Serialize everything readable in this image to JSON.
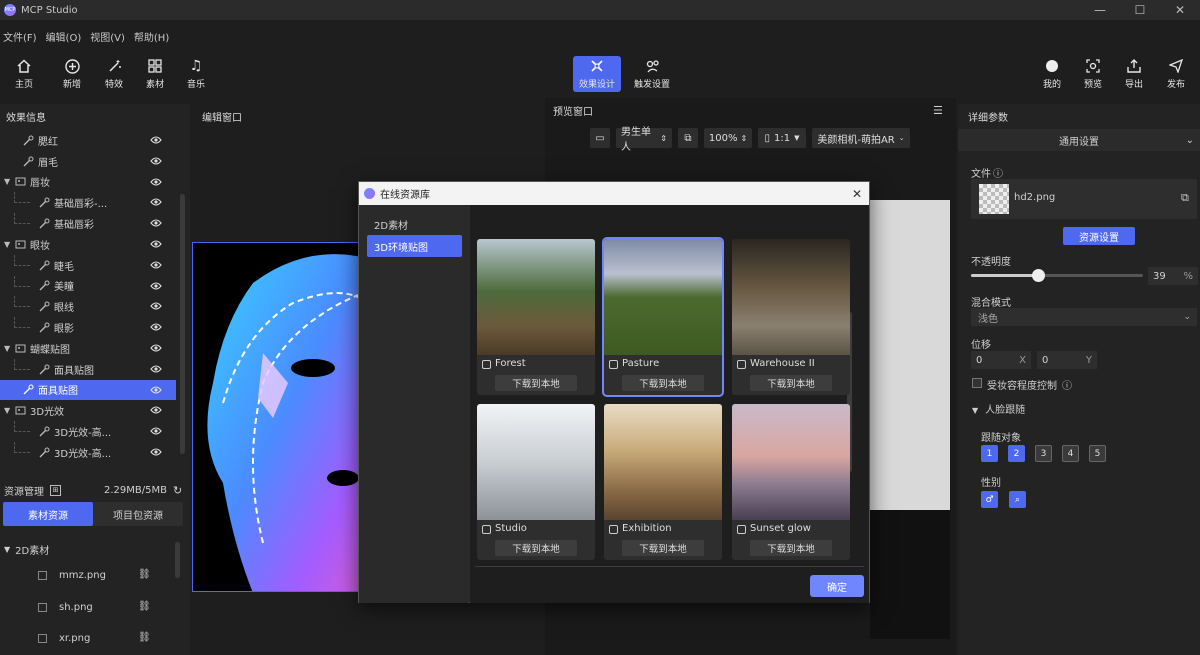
{
  "app": {
    "title": "MCP Studio",
    "logo_text": "MCP"
  },
  "menu": [
    "文件(F)",
    "编辑(O)",
    "视图(V)",
    "帮助(H)"
  ],
  "toolbar": {
    "left": [
      "主页",
      "新增",
      "特效",
      "素材",
      "音乐"
    ],
    "center": [
      "效果设计",
      "触发设置"
    ],
    "right": [
      "我的",
      "预览",
      "导出",
      "发布"
    ]
  },
  "effect_panel": {
    "title": "效果信息",
    "rows": [
      {
        "label": "腮红",
        "level": 1,
        "type": "item"
      },
      {
        "label": "眉毛",
        "level": 1,
        "type": "item"
      },
      {
        "label": "唇妆",
        "level": 0,
        "type": "group"
      },
      {
        "label": "基础唇彩-...",
        "level": 2,
        "type": "item"
      },
      {
        "label": "基础唇彩",
        "level": 2,
        "type": "item"
      },
      {
        "label": "眼妆",
        "level": 0,
        "type": "group"
      },
      {
        "label": "睫毛",
        "level": 2,
        "type": "item"
      },
      {
        "label": "美瞳",
        "level": 2,
        "type": "item"
      },
      {
        "label": "眼线",
        "level": 2,
        "type": "item"
      },
      {
        "label": "眼影",
        "level": 2,
        "type": "item"
      },
      {
        "label": "蝴蝶贴图",
        "level": 0,
        "type": "group"
      },
      {
        "label": "面具贴图",
        "level": 2,
        "type": "item"
      },
      {
        "label": "面具贴图",
        "level": 1,
        "type": "item",
        "selected": true
      },
      {
        "label": "3D光效",
        "level": 0,
        "type": "group"
      },
      {
        "label": "3D光效-高...",
        "level": 2,
        "type": "item"
      },
      {
        "label": "3D光效-高...",
        "level": 2,
        "type": "item"
      }
    ]
  },
  "resources": {
    "title": "资源管理",
    "usage": "2.29MB/5MB",
    "tabs": [
      "素材资源",
      "项目包资源"
    ],
    "group": "2D素材",
    "files": [
      "mmz.png",
      "sh.png",
      "xr.png"
    ]
  },
  "edit_window": {
    "title": "编辑窗口"
  },
  "preview_window": {
    "title": "预览窗口",
    "gender": "男生单人",
    "zoom": "100%",
    "ratio": "1:1",
    "camera": "美颜相机-萌拍AR"
  },
  "details": {
    "title": "详细参数",
    "section": "通用设置",
    "file_label": "文件",
    "file_name": "hd2.png",
    "resource_btn": "资源设置",
    "opacity_label": "不透明度",
    "opacity_value": "39",
    "opacity_unit": "%",
    "opacity_fraction": 0.39,
    "blend_label": "混合模式",
    "blend_value": "浅色",
    "position_label": "位移",
    "pos_x": "0",
    "pos_x_axis": "X",
    "pos_y": "0",
    "pos_y_axis": "Y",
    "makeup_ctrl": "受妆容程度控制",
    "face_track": "人脸跟随",
    "track_target": "跟随对象",
    "targets": [
      "1",
      "2",
      "3",
      "4",
      "5"
    ],
    "targets_active": [
      true,
      true,
      false,
      false,
      false
    ],
    "gender_label": "性别"
  },
  "modal": {
    "title": "在线资源库",
    "tabs": [
      "2D素材",
      "3D环境贴图"
    ],
    "active_tab": 1,
    "download_label": "下载到本地",
    "confirm": "确定",
    "items": [
      {
        "name": "Forest",
        "selected": false
      },
      {
        "name": "Pasture",
        "selected": true
      },
      {
        "name": "Warehouse II",
        "selected": false
      },
      {
        "name": "Studio",
        "selected": false
      },
      {
        "name": "Exhibition",
        "selected": false
      },
      {
        "name": "Sunset glow",
        "selected": false
      }
    ]
  },
  "colors": {
    "accent": "#4f68f0",
    "panel": "#232323",
    "bg": "#1e1e1e"
  }
}
